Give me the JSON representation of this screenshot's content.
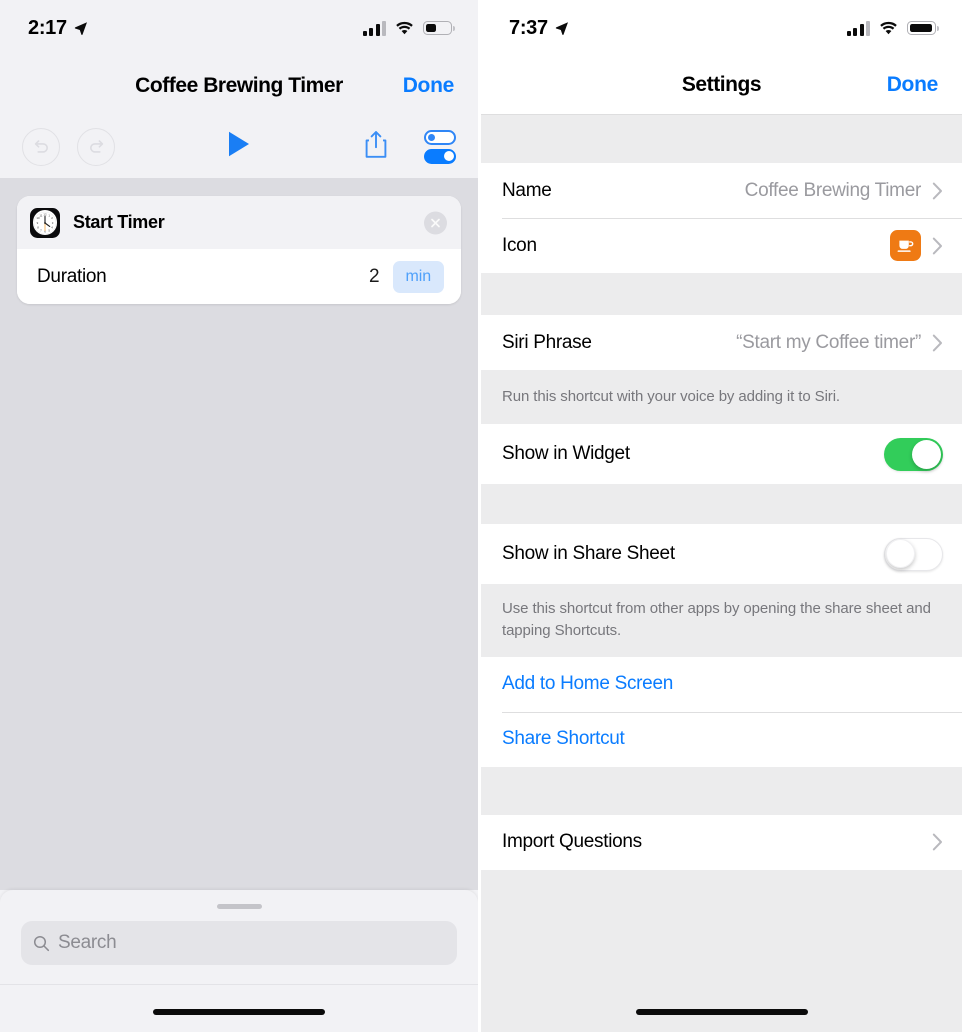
{
  "left_panel": {
    "status_bar": {
      "time": "2:17",
      "location_icon": "location-arrow-icon",
      "cellular_icon": "cellular-bars-icon",
      "wifi_icon": "wifi-icon",
      "battery_icon": "battery-icon",
      "battery_level_percent": 45
    },
    "nav": {
      "title": "Coffee Brewing Timer",
      "done_label": "Done"
    },
    "toolbar": {
      "undo_icon": "undo-icon",
      "redo_icon": "redo-icon",
      "play_icon": "play-icon",
      "share_icon": "share-icon",
      "settings_icon": "toggles-settings-icon"
    },
    "action_card": {
      "app_icon": "clock-app-icon",
      "title": "Start Timer",
      "remove_icon": "close-circle-icon",
      "parameter_label": "Duration",
      "parameter_value": "2",
      "parameter_unit": "min"
    },
    "bottom_sheet": {
      "grabber_icon": "grabber-handle",
      "search_icon": "search-icon",
      "search_value": "",
      "search_placeholder": "Search"
    },
    "home_indicator": "home-indicator"
  },
  "right_panel": {
    "status_bar": {
      "time": "7:37",
      "location_icon": "location-arrow-icon",
      "cellular_icon": "cellular-bars-icon",
      "wifi_icon": "wifi-icon",
      "battery_icon": "battery-icon",
      "battery_level_percent": 95
    },
    "nav": {
      "title": "Settings",
      "done_label": "Done"
    },
    "rows": {
      "name_label": "Name",
      "name_value": "Coffee Brewing Timer",
      "icon_label": "Icon",
      "icon_glyph": "coffee-cup-icon",
      "icon_color": "#ef7a14",
      "siri_label": "Siri Phrase",
      "siri_value": "“Start my Coffee timer”",
      "siri_footnote": "Run this shortcut with your voice by adding it to Siri.",
      "widget_label": "Show in Widget",
      "widget_enabled": "on",
      "share_sheet_label": "Show in Share Sheet",
      "share_sheet_enabled": "off",
      "share_sheet_footnote": "Use this shortcut from other apps by opening the share sheet and tapping Shortcuts.",
      "add_home_label": "Add to Home Screen",
      "share_shortcut_label": "Share Shortcut",
      "import_questions_label": "Import Questions"
    },
    "home_indicator": "home-indicator"
  },
  "colors": {
    "accent_blue": "#0a7cff",
    "toggle_green": "#32cd5a",
    "icon_orange": "#ef7a14",
    "canvas_gray": "#dcdce1",
    "group_gray": "#ececed"
  }
}
